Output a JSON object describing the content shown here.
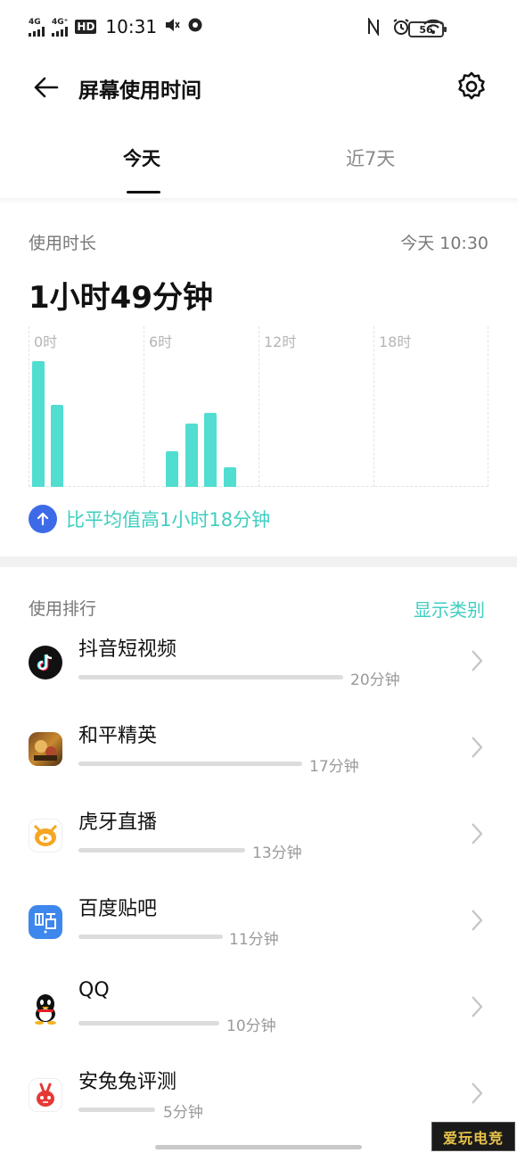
{
  "status_bar": {
    "signal1_tag": "4G",
    "signal2_tag": "4G⁺",
    "hd_badge": "HD",
    "time": "10:31",
    "battery": "56"
  },
  "header": {
    "title": "屏幕使用时间"
  },
  "tabs": [
    {
      "label": "今天",
      "active": true
    },
    {
      "label": "近7天",
      "active": false
    }
  ],
  "usage": {
    "label": "使用时长",
    "date_time": "今天 10:30",
    "total": "1小时49分钟",
    "comparison": "比平均值高1小时18分钟"
  },
  "chart_data": {
    "type": "bar",
    "tick_labels": [
      "0时",
      "6时",
      "12时",
      "18时"
    ],
    "hours": [
      0,
      1,
      2,
      3,
      4,
      5,
      6,
      7,
      8,
      9,
      10,
      11,
      12,
      13,
      14,
      15,
      16,
      17,
      18,
      19,
      20,
      21,
      22,
      23
    ],
    "values": [
      0.95,
      0.62,
      0,
      0,
      0,
      0,
      0,
      0.27,
      0.48,
      0.56,
      0.15,
      0,
      0,
      0,
      0,
      0,
      0,
      0,
      0,
      0,
      0,
      0,
      0,
      0
    ],
    "bar_color": "#52ddd1",
    "grid": true
  },
  "ranking": {
    "label": "使用排行",
    "category_link": "显示类别",
    "apps": [
      {
        "name": "抖音短视频",
        "time": "20分钟",
        "minutes": 20,
        "icon": "douyin-icon"
      },
      {
        "name": "和平精英",
        "time": "17分钟",
        "minutes": 17,
        "icon": "peace-elite-icon"
      },
      {
        "name": "虎牙直播",
        "time": "13分钟",
        "minutes": 13,
        "icon": "huya-icon"
      },
      {
        "name": "百度贴吧",
        "time": "11分钟",
        "minutes": 11,
        "icon": "tieba-icon"
      },
      {
        "name": "QQ",
        "time": "10分钟",
        "minutes": 10,
        "icon": "qq-icon"
      },
      {
        "name": "安兔兔评测",
        "time": "5分钟",
        "minutes": 5,
        "icon": "antutu-icon"
      }
    ]
  },
  "watermark": "爱玩电竞",
  "colors": {
    "accent": "#3fcec0",
    "bar": "#52ddd1",
    "compare_icon": "#3d6be8"
  }
}
